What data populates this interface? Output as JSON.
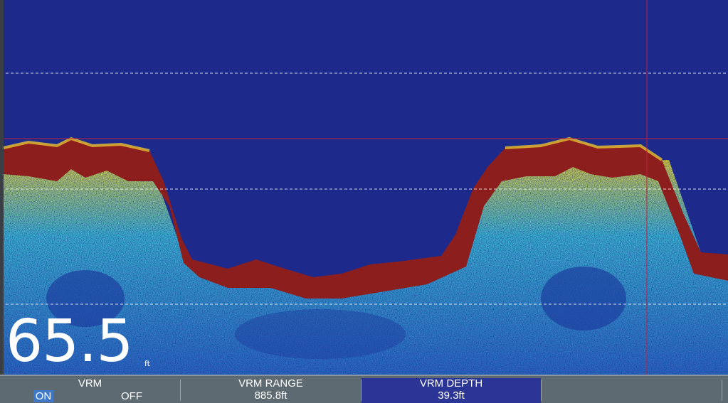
{
  "display": {
    "depth_value": "65.5",
    "depth_unit": "ft",
    "colors": {
      "water": "#1d2a8c",
      "bottom_return": "#8c1e1e",
      "vrm_line": "#c0203a",
      "grid_line": "#ffffff",
      "softkey_bar": "#5e6a72",
      "selected_key": "#2a3595",
      "on_highlight": "#3f78c8"
    },
    "icons": [
      "sonar-echogram"
    ]
  },
  "softkeys": {
    "vrm": {
      "title": "VRM",
      "on": "ON",
      "off": "OFF",
      "selected": "ON"
    },
    "vrm_range": {
      "title": "VRM RANGE",
      "value": "885.8ft"
    },
    "vrm_depth": {
      "title": "VRM DEPTH",
      "value": "39.3ft"
    },
    "empty": {
      "title": ""
    }
  }
}
